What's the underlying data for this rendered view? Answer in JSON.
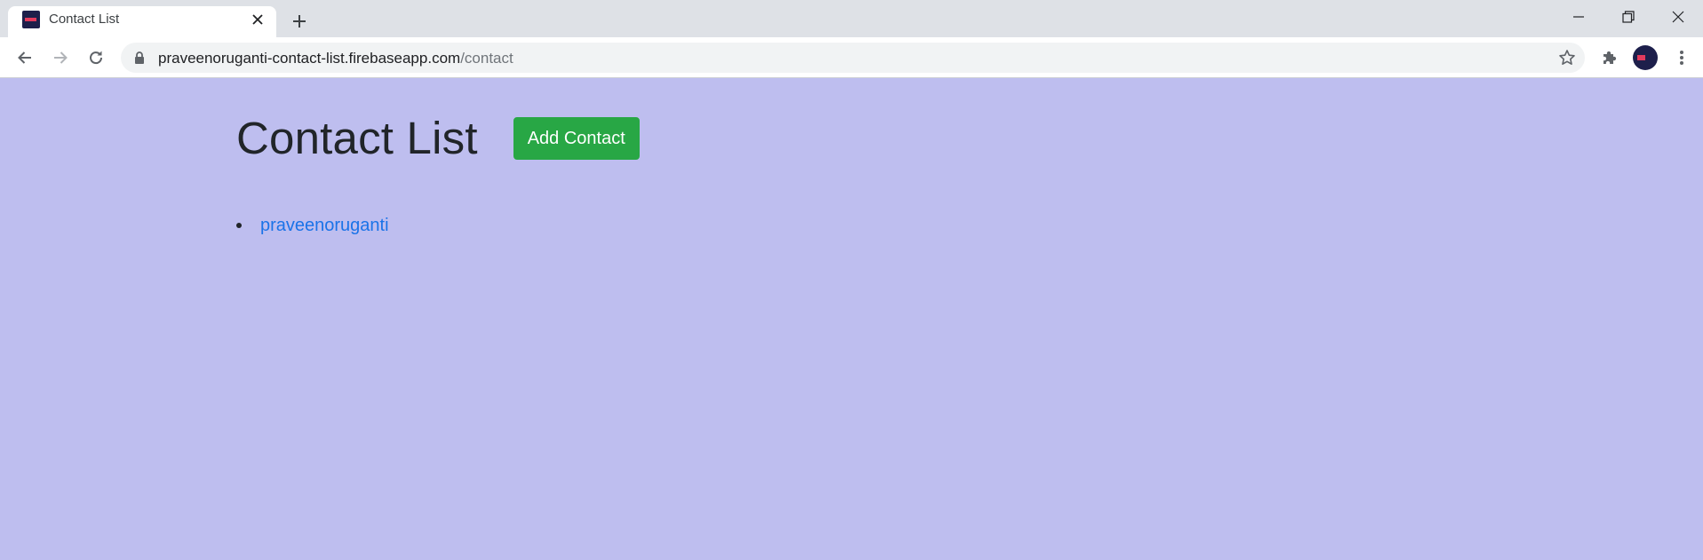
{
  "browser": {
    "tab_title": "Contact List",
    "url_host": "praveenoruganti-contact-list.firebaseapp.com",
    "url_path": "/contact",
    "icons": {
      "favicon": "site-favicon",
      "close": "close-icon",
      "new_tab": "plus-icon",
      "back": "back-arrow-icon",
      "forward": "forward-arrow-icon",
      "reload": "reload-icon",
      "lock": "lock-icon",
      "bookmark": "star-icon",
      "extensions": "puzzle-icon",
      "menu": "kebab-menu-icon"
    }
  },
  "page": {
    "title": "Contact List",
    "add_button_label": "Add Contact",
    "contacts": [
      {
        "name": "praveenoruganti"
      }
    ],
    "colors": {
      "background": "#bebeef",
      "button": "#28a745",
      "link": "#1a73e8"
    }
  }
}
